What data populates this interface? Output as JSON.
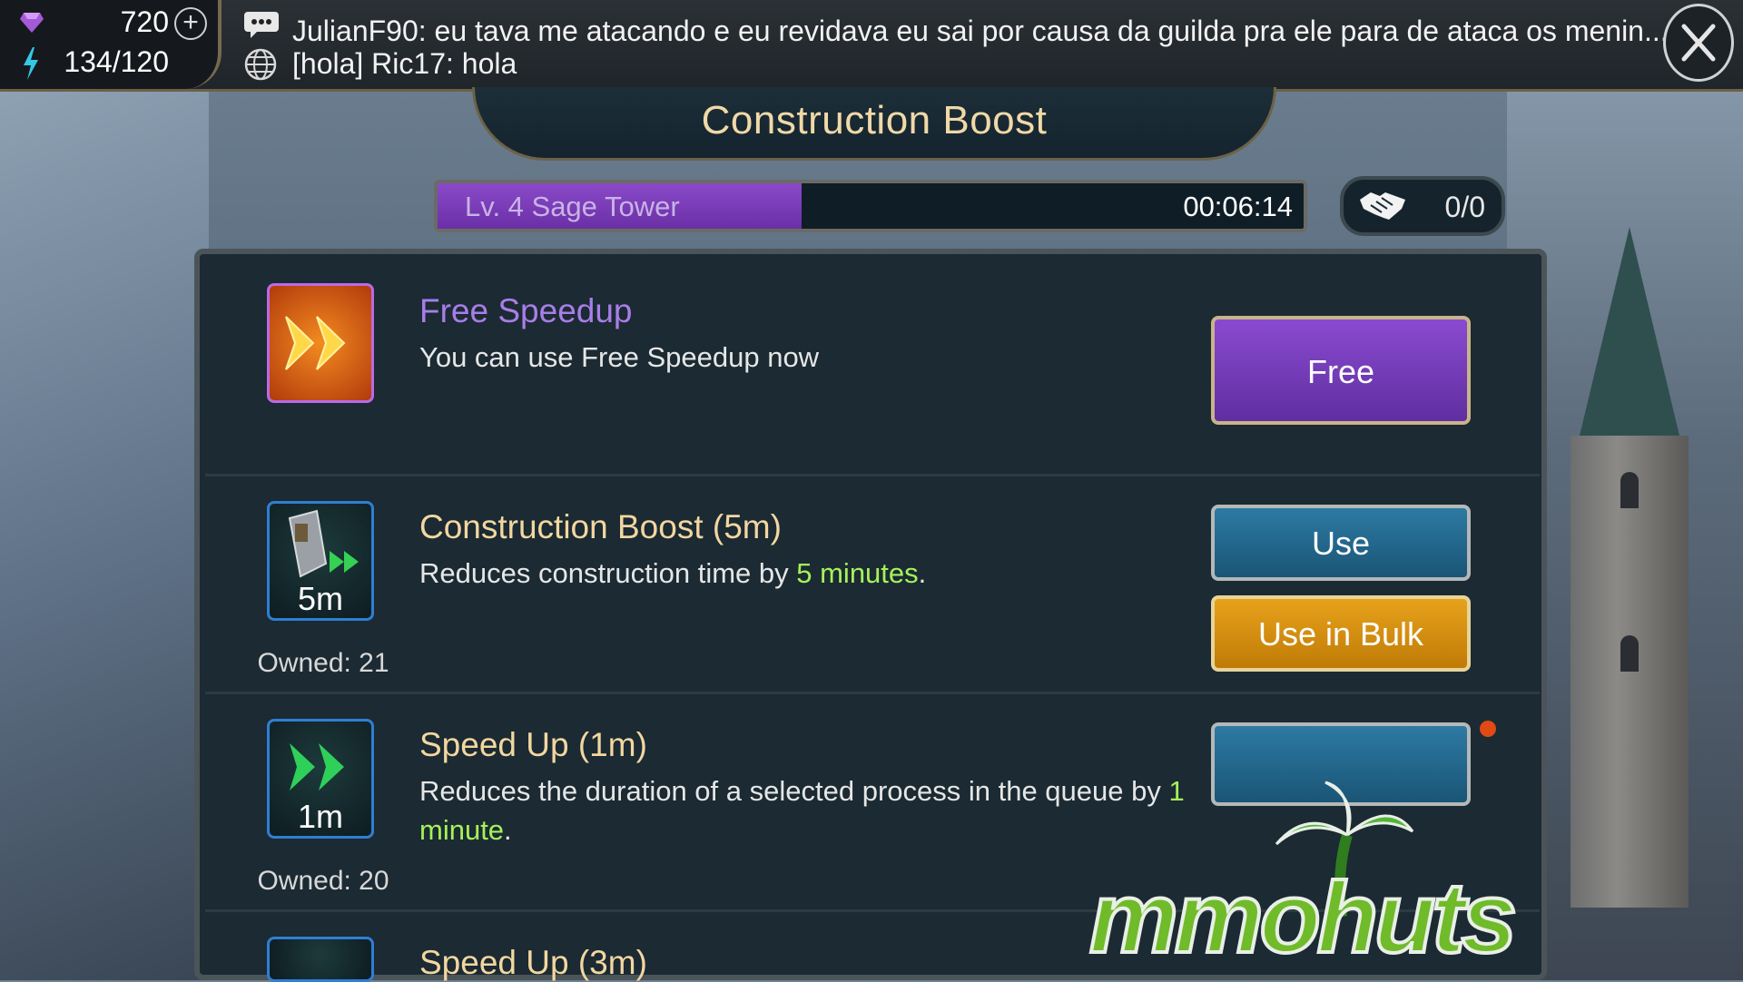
{
  "resources": {
    "gems": "720",
    "energy": "134/120"
  },
  "chat": {
    "line1": "JulianF90: eu tava me atacando e eu revidava eu sai por causa da guilda pra ele para de ataca os menin...",
    "line2": "[hola] Ric17: hola"
  },
  "dialog": {
    "title": "Construction Boost"
  },
  "progress": {
    "label": "Lv. 4 Sage Tower",
    "time": "00:06:14",
    "fraction": 0.42
  },
  "help": {
    "count": "0/0"
  },
  "items": [
    {
      "title": "Free Speedup",
      "description": "You can use Free Speedup now",
      "button": "Free"
    },
    {
      "title": "Construction Boost (5m)",
      "icon_label": "5m",
      "desc_prefix": "Reduces construction time by ",
      "desc_highlight": "5 minutes",
      "desc_suffix": ".",
      "owned": "Owned: 21",
      "use_button": "Use",
      "bulk_button": "Use in Bulk"
    },
    {
      "title": "Speed Up (1m)",
      "icon_label": "1m",
      "desc_prefix": "Reduces the duration of a selected process in the queue by ",
      "desc_highlight": "1 minute",
      "desc_suffix": ".",
      "owned": "Owned: 20"
    },
    {
      "title": "Speed Up (3m)"
    }
  ],
  "watermark": {
    "text": "mmohuts"
  },
  "colors": {
    "accent_purple": "#8a4ad0",
    "accent_teal": "#2d7aa3",
    "accent_gold": "#e7a21b",
    "highlight_green": "#a6f15a",
    "title_gold": "#f0d9a8"
  }
}
